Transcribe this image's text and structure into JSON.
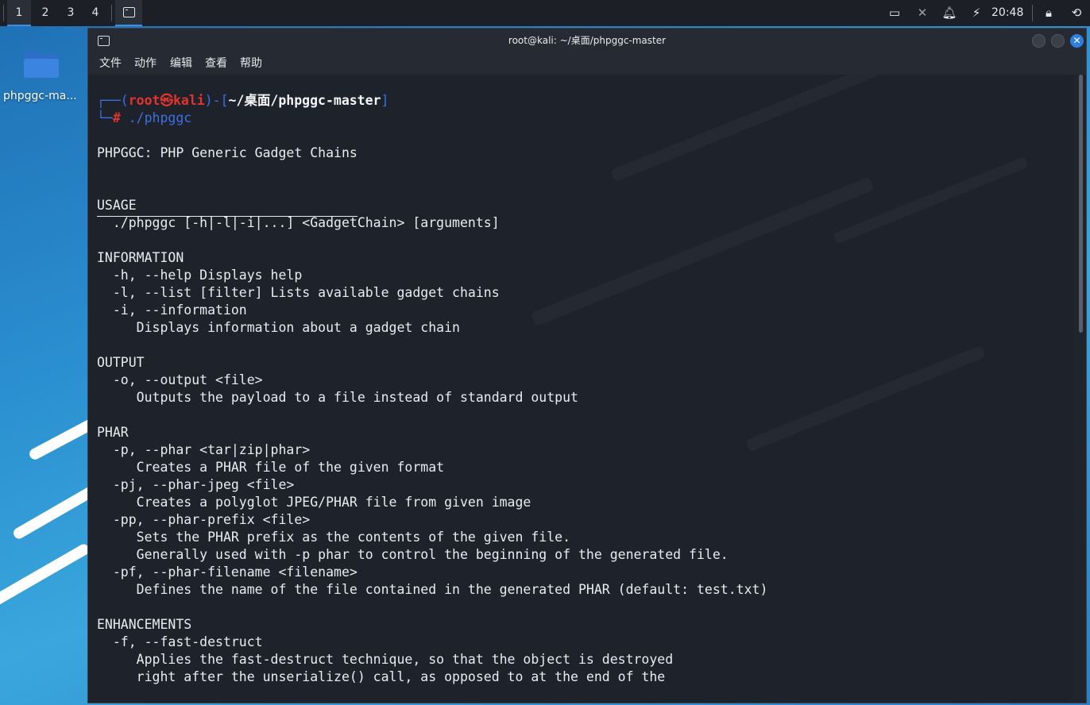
{
  "taskbar": {
    "workspaces": [
      "1",
      "2",
      "3",
      "4"
    ],
    "clock": "20:48"
  },
  "desktop": {
    "icon_label": "phpggc-ma..."
  },
  "window": {
    "title": "root@kali: ~/桌面/phpggc-master",
    "menu": [
      "文件",
      "动作",
      "编辑",
      "查看",
      "帮助"
    ]
  },
  "terminal": {
    "prompt": {
      "open": "┌──(",
      "user": "root㉿kali",
      "mid": ")-[",
      "path": "~/桌面/phpggc-master",
      "close": "]",
      "corner": "└─",
      "hash": "#",
      "command": " ./phpggc"
    },
    "lines": [
      "PHPGGC: PHP Generic Gadget Chains",
      "",
      "",
      "USAGE",
      "  ./phpggc [-h|-l|-i|...] <GadgetChain> [arguments]",
      "",
      "INFORMATION",
      "  -h, --help Displays help",
      "  -l, --list [filter] Lists available gadget chains",
      "  -i, --information",
      "     Displays information about a gadget chain",
      "",
      "OUTPUT",
      "  -o, --output <file>",
      "     Outputs the payload to a file instead of standard output",
      "",
      "PHAR",
      "  -p, --phar <tar|zip|phar>",
      "     Creates a PHAR file of the given format",
      "  -pj, --phar-jpeg <file>",
      "     Creates a polyglot JPEG/PHAR file from given image",
      "  -pp, --phar-prefix <file>",
      "     Sets the PHAR prefix as the contents of the given file.",
      "     Generally used with -p phar to control the beginning of the generated file.",
      "  -pf, --phar-filename <filename>",
      "     Defines the name of the file contained in the generated PHAR (default: test.txt)",
      "",
      "ENHANCEMENTS",
      "  -f, --fast-destruct",
      "     Applies the fast-destruct technique, so that the object is destroyed",
      "     right after the unserialize() call, as opposed to at the end of the"
    ]
  },
  "colors": {
    "prompt_blue": "#3d6fe0",
    "prompt_red": "#e0342c",
    "terminal_bg": "#1e222b",
    "accent": "#2f7fe0"
  }
}
